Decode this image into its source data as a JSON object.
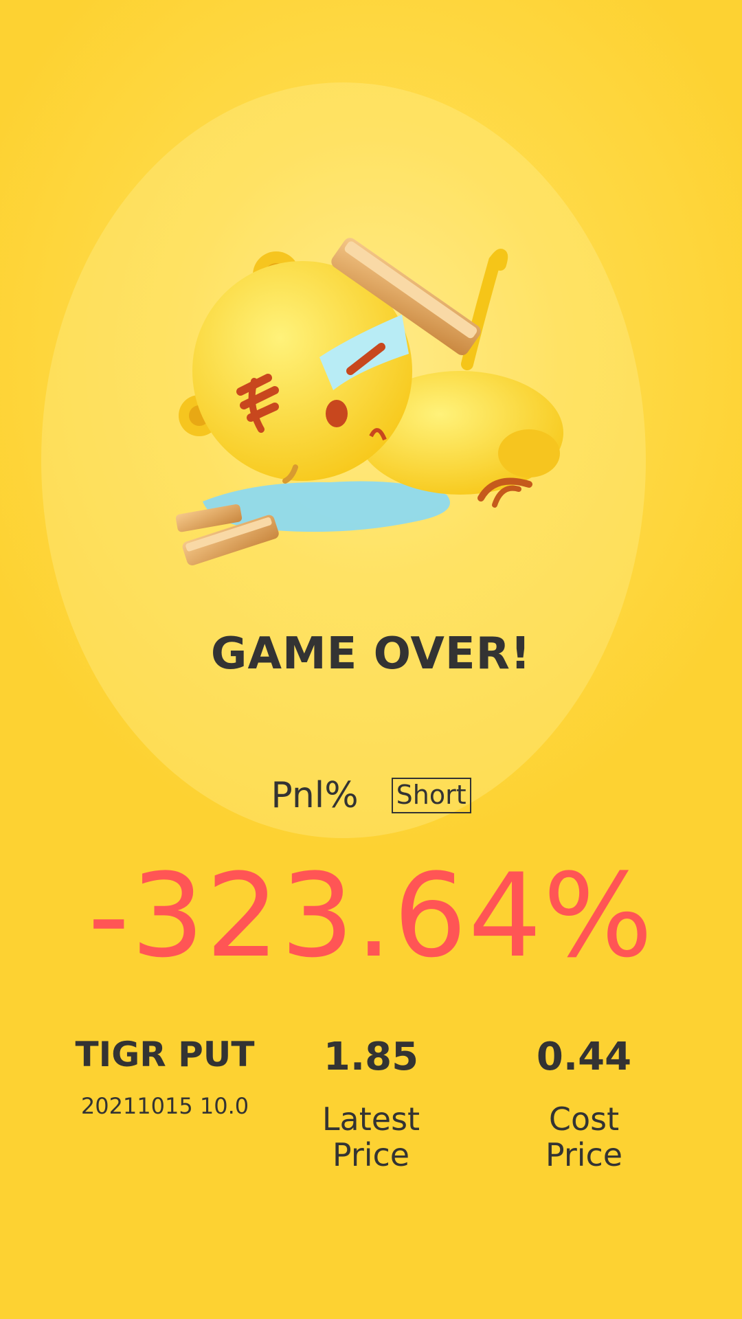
{
  "mascot": {
    "icon": "fallen-tiger-mascot-icon"
  },
  "title": "GAME OVER!",
  "pnl": {
    "label": "Pnl%",
    "badge": "Short",
    "value": "-323.64%",
    "value_color": "#ff5555"
  },
  "position": {
    "ticker": "TIGR PUT",
    "contract": "20211015 10.0",
    "latest_price": "1.85",
    "latest_price_label_1": "Latest",
    "latest_price_label_2": "Price",
    "cost_price": "0.44",
    "cost_price_label_1": "Cost",
    "cost_price_label_2": "Price"
  },
  "colors": {
    "background": "#fdd232",
    "text": "#333333",
    "loss": "#ff5555"
  }
}
